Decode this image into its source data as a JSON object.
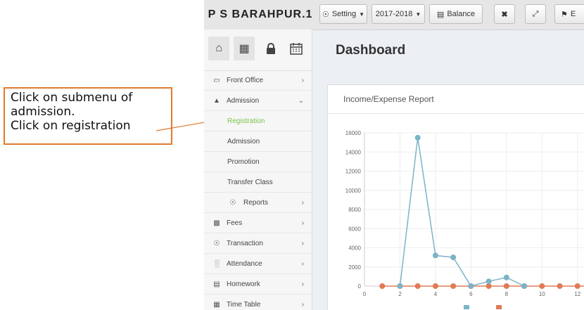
{
  "annotation": {
    "lines": [
      "Click on submenu of",
      "admission.",
      "Click on registration"
    ],
    "color": "#e07a2e"
  },
  "header": {
    "brand": "P S BARAHPUR.1",
    "setting": "Setting",
    "session": "2017-2018",
    "balance": "Balance",
    "cut_label": "E"
  },
  "quick_links": [
    "home-icon",
    "map-icon",
    "lock-icon",
    "calendar-icon"
  ],
  "sidebar": {
    "items": [
      {
        "label": "Front Office",
        "icon": "monitor-icon"
      },
      {
        "label": "Admission",
        "icon": "graduation-cap-icon",
        "expanded": true
      },
      {
        "label": "Registration",
        "sub": true,
        "active": true
      },
      {
        "label": "Admission",
        "sub": true
      },
      {
        "label": "Promotion",
        "sub": true
      },
      {
        "label": "Transfer Class",
        "sub": true
      },
      {
        "label": "Reports",
        "sub": true,
        "icon": "globe-icon"
      },
      {
        "label": "Fees",
        "icon": "money-icon"
      },
      {
        "label": "Transaction",
        "icon": "globe-icon"
      },
      {
        "label": "Attendance",
        "icon": "bar-chart-icon"
      },
      {
        "label": "Homework",
        "icon": "file-icon"
      },
      {
        "label": "Time Table",
        "icon": "calendar-icon"
      }
    ]
  },
  "main": {
    "title": "Dashboard",
    "panel_title": "Income/Expense Report"
  },
  "chart_data": {
    "type": "line",
    "title": "",
    "xlabel": "",
    "ylabel": "",
    "xlim": [
      0,
      13
    ],
    "ylim": [
      0,
      16000
    ],
    "x_ticks": [
      0,
      2,
      4,
      6,
      8,
      10,
      12
    ],
    "y_ticks": [
      0,
      2000,
      4000,
      6000,
      8000,
      10000,
      12000,
      14000,
      16000
    ],
    "grid": true,
    "legend": "bottom",
    "series": [
      {
        "color": "#7bb3c8",
        "x": [
          2,
          3,
          4,
          5,
          6,
          7,
          8,
          9
        ],
        "values": [
          0,
          15500,
          3200,
          3000,
          0,
          500,
          900,
          0
        ]
      },
      {
        "color": "#e07b55",
        "x": [
          1,
          2,
          3,
          4,
          5,
          6,
          7,
          8,
          9,
          10,
          11,
          12,
          13
        ],
        "values": [
          0,
          0,
          0,
          0,
          0,
          0,
          0,
          0,
          0,
          0,
          0,
          0,
          0
        ]
      }
    ]
  }
}
